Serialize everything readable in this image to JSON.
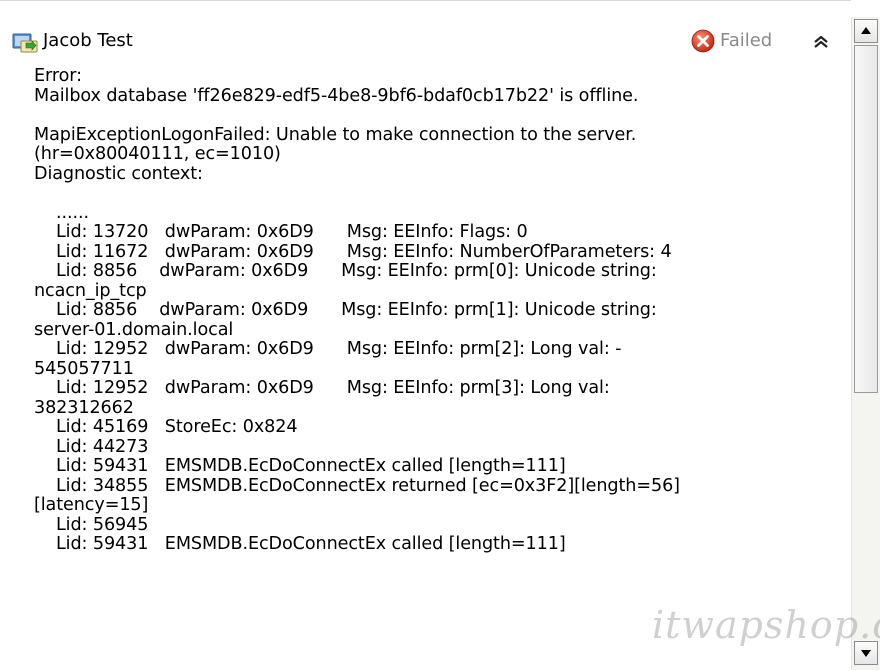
{
  "header": {
    "title": "Jacob Test",
    "status": "Failed",
    "app_icon": "migration-mailbox-icon",
    "status_icon": "error-x-icon",
    "collapse_icon": "double-chevron-up-icon"
  },
  "log_lines": [
    "Error:",
    "Mailbox database 'ff26e829-edf5-4be8-9bf6-bdaf0cb17b22' is offline.",
    "",
    "MapiExceptionLogonFailed: Unable to make connection to the server.",
    "(hr=0x80040111, ec=1010)",
    "Diagnostic context:",
    "",
    "    ......",
    "    Lid: 13720   dwParam: 0x6D9      Msg: EEInfo: Flags: 0",
    "    Lid: 11672   dwParam: 0x6D9      Msg: EEInfo: NumberOfParameters: 4",
    "    Lid: 8856    dwParam: 0x6D9      Msg: EEInfo: prm[0]: Unicode string:",
    "ncacn_ip_tcp",
    "    Lid: 8856    dwParam: 0x6D9      Msg: EEInfo: prm[1]: Unicode string:",
    "server-01.domain.local",
    "    Lid: 12952   dwParam: 0x6D9      Msg: EEInfo: prm[2]: Long val: -",
    "545057711",
    "    Lid: 12952   dwParam: 0x6D9      Msg: EEInfo: prm[3]: Long val:",
    "382312662",
    "    Lid: 45169   StoreEc: 0x824",
    "    Lid: 44273",
    "    Lid: 59431   EMSMDB.EcDoConnectEx called [length=111]",
    "    Lid: 34855   EMSMDB.EcDoConnectEx returned [ec=0x3F2][length=56]",
    "[latency=15]",
    "    Lid: 56945",
    "    Lid: 59431   EMSMDB.EcDoConnectEx called [length=111]"
  ],
  "watermark": "itwapshop.com",
  "colors": {
    "status_text": "#8a8a8a",
    "error_red": "#d9301c"
  }
}
